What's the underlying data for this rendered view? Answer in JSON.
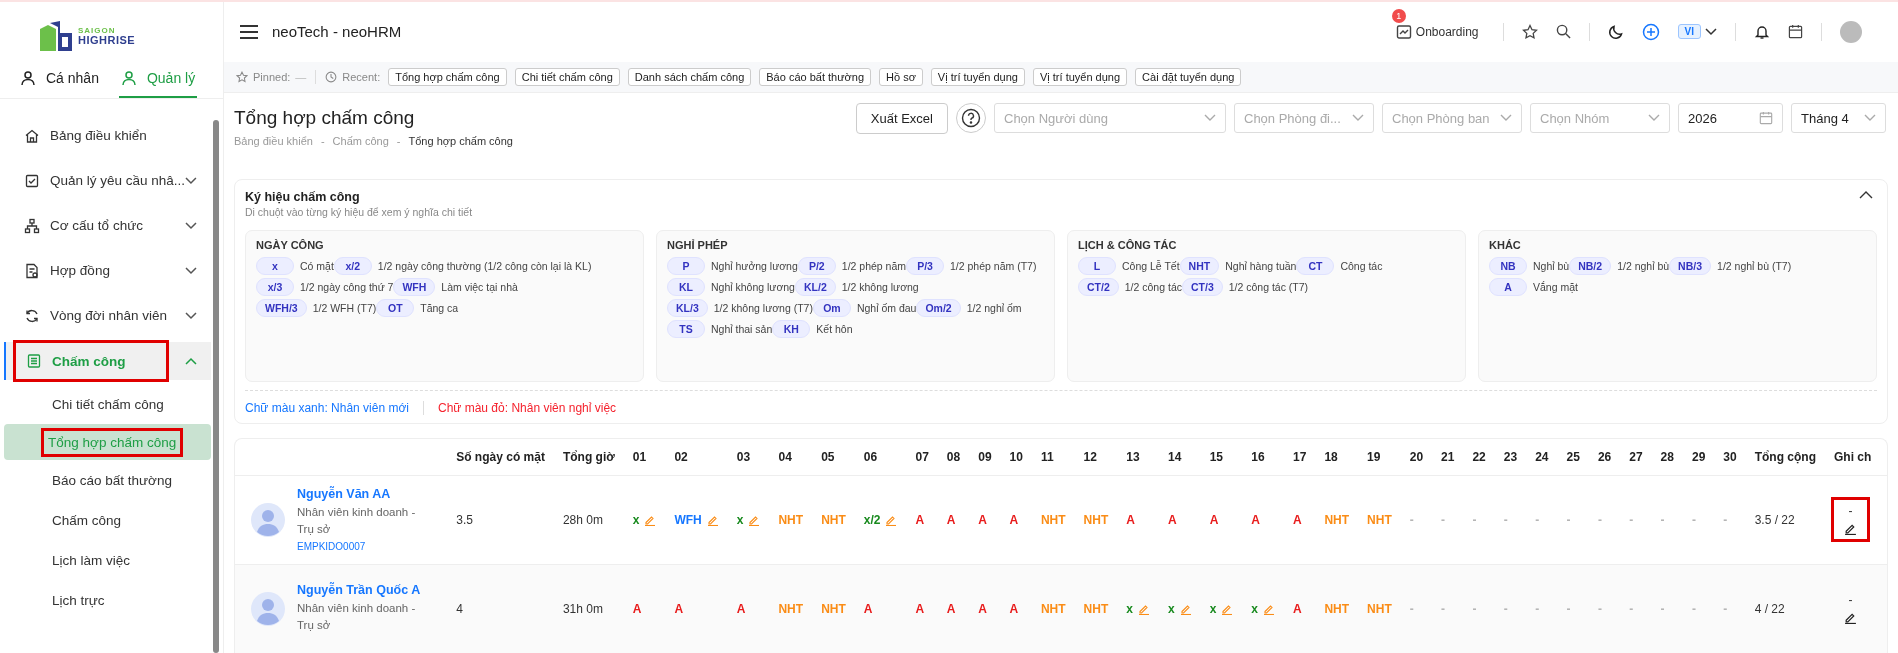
{
  "logo": {
    "top": "SAIGON",
    "bottom": "HIGHRISE"
  },
  "sidebar": {
    "tabs": [
      {
        "label": "Cá nhân",
        "selected": false
      },
      {
        "label": "Quản lý",
        "selected": true
      }
    ],
    "items": [
      {
        "label": "Bảng điều khiển",
        "selected": false
      },
      {
        "label": "Quản lý yêu cầu nhâ...",
        "selected": false,
        "expanded": false
      },
      {
        "label": "Cơ cấu tổ chức",
        "selected": false,
        "expanded": false
      },
      {
        "label": "Hợp đồng",
        "selected": false,
        "expanded": false
      },
      {
        "label": "Vòng đời nhân viên",
        "selected": false,
        "expanded": false
      },
      {
        "label": "Chấm công",
        "selected": true,
        "expanded": true,
        "highlighted": true,
        "children": [
          {
            "label": "Chi tiết chấm công",
            "selected": false
          },
          {
            "label": "Tổng hợp chấm công",
            "selected": true,
            "highlighted": true
          },
          {
            "label": "Báo cáo bất thường",
            "selected": false
          },
          {
            "label": "Chấm công",
            "selected": false
          },
          {
            "label": "Lịch làm việc",
            "selected": false
          },
          {
            "label": "Lịch trực",
            "selected": false
          }
        ]
      }
    ]
  },
  "topbar": {
    "title": "neoTech - neoHRM",
    "onboarding": {
      "label": "Onboarding",
      "badge": "1"
    },
    "language": "VI"
  },
  "recent_bar": {
    "pinned_label": "Pinned:",
    "pinned_value": "—",
    "recent_label": "Recent:",
    "items": [
      "Tổng hợp chấm công",
      "Chi tiết chấm công",
      "Danh sách chấm công",
      "Báo cáo bất thường",
      "Hồ sơ",
      "Vị trí tuyển dụng",
      "Vị trí tuyển dụng",
      "Cài đặt tuyển dụng"
    ]
  },
  "page": {
    "title": "Tổng hợp chấm công",
    "breadcrumb": [
      "Bảng điều khiển",
      "Chấm công",
      "Tổng hợp chấm công"
    ],
    "breadcrumb_separator": "-",
    "export_button": "Xuất Excel",
    "filters": [
      {
        "kind": "select",
        "placeholder": "Chọn Người dùng"
      },
      {
        "kind": "select",
        "placeholder": "Chọn Phòng đi..."
      },
      {
        "kind": "select",
        "placeholder": "Chọn Phòng ban"
      },
      {
        "kind": "select",
        "placeholder": "Chọn Nhóm"
      },
      {
        "kind": "date",
        "value": "2026"
      },
      {
        "kind": "select",
        "value": "Tháng 4"
      }
    ]
  },
  "legend": {
    "title": "Ký hiệu chấm công",
    "subtitle": "Di chuột vào từng ký hiệu để xem ý nghĩa chi tiết",
    "expanded": true,
    "groups": [
      {
        "title": "NGÀY CÔNG",
        "items": [
          {
            "code": "x",
            "label": "Có mặt"
          },
          {
            "code": "x/2",
            "label": "1/2 ngày công thường (1/2 công còn lại là KL)"
          },
          {
            "code": "x/3",
            "label": "1/2 ngày công thứ 7"
          },
          {
            "code": "WFH",
            "label": "Làm việc tại nhà"
          },
          {
            "code": "WFH/3",
            "label": "1/2 WFH (T7)"
          },
          {
            "code": "OT",
            "label": "Tăng ca"
          }
        ]
      },
      {
        "title": "NGHỈ PHÉP",
        "items": [
          {
            "code": "P",
            "label": "Nghỉ hưởng lương"
          },
          {
            "code": "P/2",
            "label": "1/2 phép năm"
          },
          {
            "code": "P/3",
            "label": "1/2 phép năm (T7)"
          },
          {
            "code": "KL",
            "label": "Nghỉ không lương"
          },
          {
            "code": "KL/2",
            "label": "1/2 không lương"
          },
          {
            "code": "KL/3",
            "label": "1/2 không lương (T7)"
          },
          {
            "code": "Om",
            "label": "Nghỉ ốm đau"
          },
          {
            "code": "Om/2",
            "label": "1/2 nghỉ ốm"
          },
          {
            "code": "TS",
            "label": "Nghỉ thai sản"
          },
          {
            "code": "KH",
            "label": "Kết hôn"
          }
        ]
      },
      {
        "title": "LỊCH & CÔNG TÁC",
        "items": [
          {
            "code": "L",
            "label": "Công Lễ Tết"
          },
          {
            "code": "NHT",
            "label": "Nghỉ hàng tuần"
          },
          {
            "code": "CT",
            "label": "Công tác"
          },
          {
            "code": "CT/2",
            "label": "1/2 công tác"
          },
          {
            "code": "CT/3",
            "label": "1/2 công tác (T7)"
          }
        ]
      },
      {
        "title": "KHÁC",
        "items": [
          {
            "code": "NB",
            "label": "Nghỉ bù"
          },
          {
            "code": "NB/2",
            "label": "1/2 nghỉ bù"
          },
          {
            "code": "NB/3",
            "label": "1/2 nghỉ bù (T7)"
          },
          {
            "code": "A",
            "label": "Vắng mặt"
          }
        ]
      }
    ],
    "notes": [
      {
        "text": "Chữ màu xanh: Nhân viên mới",
        "color": "#1677ff"
      },
      {
        "text": "Chữ màu đỏ: Nhân viên nghỉ việc",
        "color": "#f5222d"
      }
    ]
  },
  "table": {
    "columns": [
      "",
      "Số ngày có mặt",
      "Tổng giờ",
      "01",
      "02",
      "03",
      "04",
      "05",
      "06",
      "07",
      "08",
      "09",
      "10",
      "11",
      "12",
      "13",
      "14",
      "15",
      "16",
      "17",
      "18",
      "19",
      "20",
      "21",
      "22",
      "23",
      "24",
      "25",
      "26",
      "27",
      "28",
      "29",
      "30",
      "Tổng cộng",
      "Ghi ch"
    ],
    "rows": [
      {
        "employee": {
          "name": "Nguyễn Văn AA",
          "role": "Nhân viên kinh doanh - Trụ sở",
          "code": "EMPKIDO0007"
        },
        "days_present": "3.5",
        "hours": "28h 0m",
        "days": [
          {
            "code": "x",
            "kind": "present",
            "editable": true
          },
          {
            "code": "WFH",
            "kind": "wfh",
            "editable": true
          },
          {
            "code": "x",
            "kind": "present",
            "editable": true
          },
          {
            "code": "NHT",
            "kind": "weekly_off"
          },
          {
            "code": "NHT",
            "kind": "weekly_off"
          },
          {
            "code": "x/2",
            "kind": "present",
            "editable": true
          },
          {
            "code": "A",
            "kind": "absent"
          },
          {
            "code": "A",
            "kind": "absent"
          },
          {
            "code": "A",
            "kind": "absent"
          },
          {
            "code": "A",
            "kind": "absent"
          },
          {
            "code": "NHT",
            "kind": "weekly_off"
          },
          {
            "code": "NHT",
            "kind": "weekly_off"
          },
          {
            "code": "A",
            "kind": "absent"
          },
          {
            "code": "A",
            "kind": "absent"
          },
          {
            "code": "A",
            "kind": "absent"
          },
          {
            "code": "A",
            "kind": "absent"
          },
          {
            "code": "A",
            "kind": "absent"
          },
          {
            "code": "NHT",
            "kind": "weekly_off"
          },
          {
            "code": "NHT",
            "kind": "weekly_off"
          },
          {
            "code": "-",
            "kind": "empty"
          },
          {
            "code": "-",
            "kind": "empty"
          },
          {
            "code": "-",
            "kind": "empty"
          },
          {
            "code": "-",
            "kind": "empty"
          },
          {
            "code": "-",
            "kind": "empty"
          },
          {
            "code": "-",
            "kind": "empty"
          },
          {
            "code": "-",
            "kind": "empty"
          },
          {
            "code": "-",
            "kind": "empty"
          },
          {
            "code": "-",
            "kind": "empty"
          },
          {
            "code": "-",
            "kind": "empty"
          },
          {
            "code": "-",
            "kind": "empty"
          }
        ],
        "total": "3.5 / 22",
        "note": "-",
        "note_highlighted": true
      },
      {
        "employee": {
          "name": "Nguyễn Trần Quốc A",
          "role": "Nhân viên kinh doanh - Trụ sở"
        },
        "days_present": "4",
        "hours": "31h 0m",
        "days": [
          {
            "code": "A",
            "kind": "absent"
          },
          {
            "code": "A",
            "kind": "absent"
          },
          {
            "code": "A",
            "kind": "absent"
          },
          {
            "code": "NHT",
            "kind": "weekly_off"
          },
          {
            "code": "NHT",
            "kind": "weekly_off"
          },
          {
            "code": "A",
            "kind": "absent"
          },
          {
            "code": "A",
            "kind": "absent"
          },
          {
            "code": "A",
            "kind": "absent"
          },
          {
            "code": "A",
            "kind": "absent"
          },
          {
            "code": "A",
            "kind": "absent"
          },
          {
            "code": "NHT",
            "kind": "weekly_off"
          },
          {
            "code": "NHT",
            "kind": "weekly_off"
          },
          {
            "code": "x",
            "kind": "present",
            "editable": true
          },
          {
            "code": "x",
            "kind": "present",
            "editable": true
          },
          {
            "code": "x",
            "kind": "present",
            "editable": true
          },
          {
            "code": "x",
            "kind": "present",
            "editable": true
          },
          {
            "code": "A",
            "kind": "absent"
          },
          {
            "code": "NHT",
            "kind": "weekly_off"
          },
          {
            "code": "NHT",
            "kind": "weekly_off"
          },
          {
            "code": "-",
            "kind": "empty"
          },
          {
            "code": "-",
            "kind": "empty"
          },
          {
            "code": "-",
            "kind": "empty"
          },
          {
            "code": "-",
            "kind": "empty"
          },
          {
            "code": "-",
            "kind": "empty"
          },
          {
            "code": "-",
            "kind": "empty"
          },
          {
            "code": "-",
            "kind": "empty"
          },
          {
            "code": "-",
            "kind": "empty"
          },
          {
            "code": "-",
            "kind": "empty"
          },
          {
            "code": "-",
            "kind": "empty"
          },
          {
            "code": "-",
            "kind": "empty"
          }
        ],
        "total": "4 / 22",
        "note": "-",
        "note_highlighted": false
      }
    ]
  }
}
